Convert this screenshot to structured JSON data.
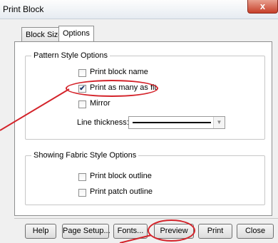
{
  "window": {
    "title": "Print Block",
    "close_glyph": "x"
  },
  "tabs": [
    {
      "label": "Block Size",
      "active": false
    },
    {
      "label": "Options",
      "active": true
    }
  ],
  "pattern_group": {
    "legend": "Pattern Style Options",
    "items": [
      {
        "label": "Print block name",
        "checked": false
      },
      {
        "label": "Print as many as fit",
        "checked": true
      },
      {
        "label": "Mirror",
        "checked": false
      }
    ],
    "line_thickness_label": "Line thickness:"
  },
  "fabric_group": {
    "legend": "Showing Fabric Style Options",
    "items": [
      {
        "label": "Print block outline",
        "checked": false
      },
      {
        "label": "Print patch outline",
        "checked": false
      }
    ]
  },
  "buttons": {
    "help": "Help",
    "page_setup": "Page Setup...",
    "fonts": "Fonts...",
    "preview": "Preview",
    "print": "Print",
    "close": "Close"
  },
  "colors": {
    "highlight": "#d4232a",
    "close_button": "#c7402a"
  },
  "icons": {
    "checkmark": "✔",
    "dropdown": "▼"
  }
}
